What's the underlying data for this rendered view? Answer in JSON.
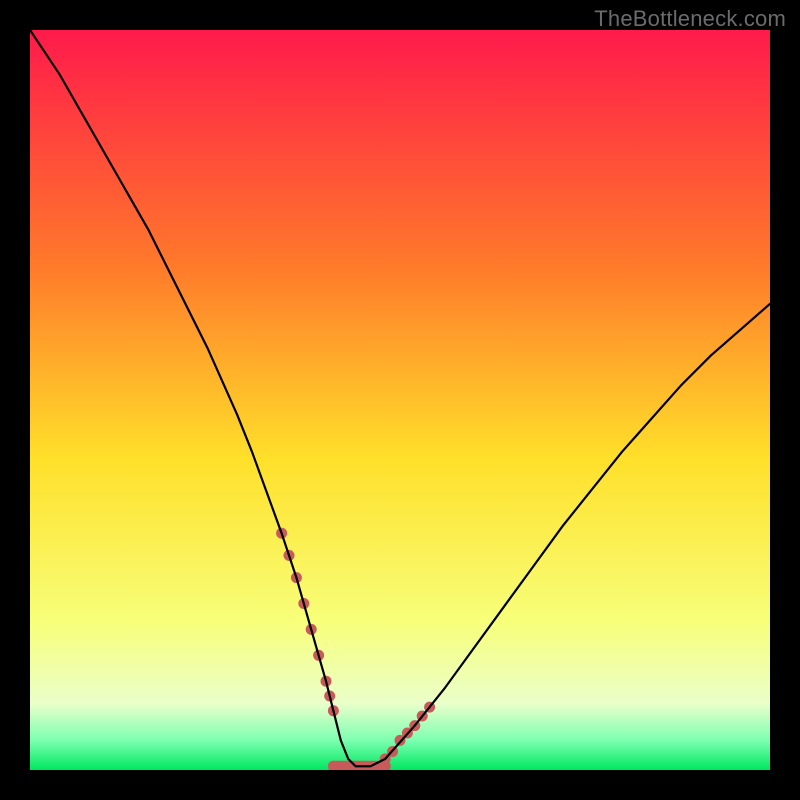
{
  "watermark": {
    "text": "TheBottleneck.com"
  },
  "colors": {
    "background": "#000000",
    "gradient_top": "#ff1a4b",
    "gradient_mid1": "#ff7a2a",
    "gradient_mid2": "#ffe02a",
    "gradient_low": "#f7ff7a",
    "gradient_pale": "#eaffca",
    "gradient_band": "#7cffb0",
    "gradient_bottom": "#00e860",
    "curve": "#000000",
    "marker": "#c85a5a"
  },
  "chart_data": {
    "type": "line",
    "title": "",
    "xlabel": "",
    "ylabel": "",
    "xlim": [
      0,
      100
    ],
    "ylim": [
      0,
      100
    ],
    "grid": false,
    "legend": false,
    "series": [
      {
        "name": "bottleneck-curve",
        "x": [
          0,
          4,
          8,
          12,
          16,
          20,
          24,
          28,
          30,
          32,
          34,
          36,
          38,
          40,
          41,
          42,
          43,
          44,
          46,
          48,
          52,
          56,
          60,
          64,
          68,
          72,
          76,
          80,
          84,
          88,
          92,
          96,
          100
        ],
        "y": [
          100,
          94,
          87,
          80,
          73,
          65,
          57,
          48,
          43,
          37.5,
          32,
          26,
          19,
          12,
          8,
          4,
          1.5,
          0.5,
          0.5,
          1.5,
          6,
          11,
          16.5,
          22,
          27.5,
          33,
          38,
          43,
          47.5,
          52,
          56,
          59.5,
          63
        ]
      }
    ],
    "annotations": {
      "markers_description": "salmon dotted segments near the curve minimum on both sides plus a short flat segment at the bottom",
      "marker_points_left": [
        [
          34,
          32
        ],
        [
          35,
          29
        ],
        [
          36,
          26
        ],
        [
          37,
          22.5
        ],
        [
          38,
          19
        ],
        [
          39,
          15.5
        ],
        [
          40,
          12
        ],
        [
          40.5,
          10
        ],
        [
          41,
          8
        ]
      ],
      "marker_points_right": [
        [
          48,
          1.5
        ],
        [
          49,
          2.5
        ],
        [
          50,
          4
        ],
        [
          51,
          5
        ],
        [
          52,
          6
        ],
        [
          53,
          7.3
        ],
        [
          54,
          8.5
        ]
      ],
      "marker_flat_bottom": [
        [
          41,
          0.5
        ],
        [
          48,
          0.5
        ]
      ]
    }
  }
}
